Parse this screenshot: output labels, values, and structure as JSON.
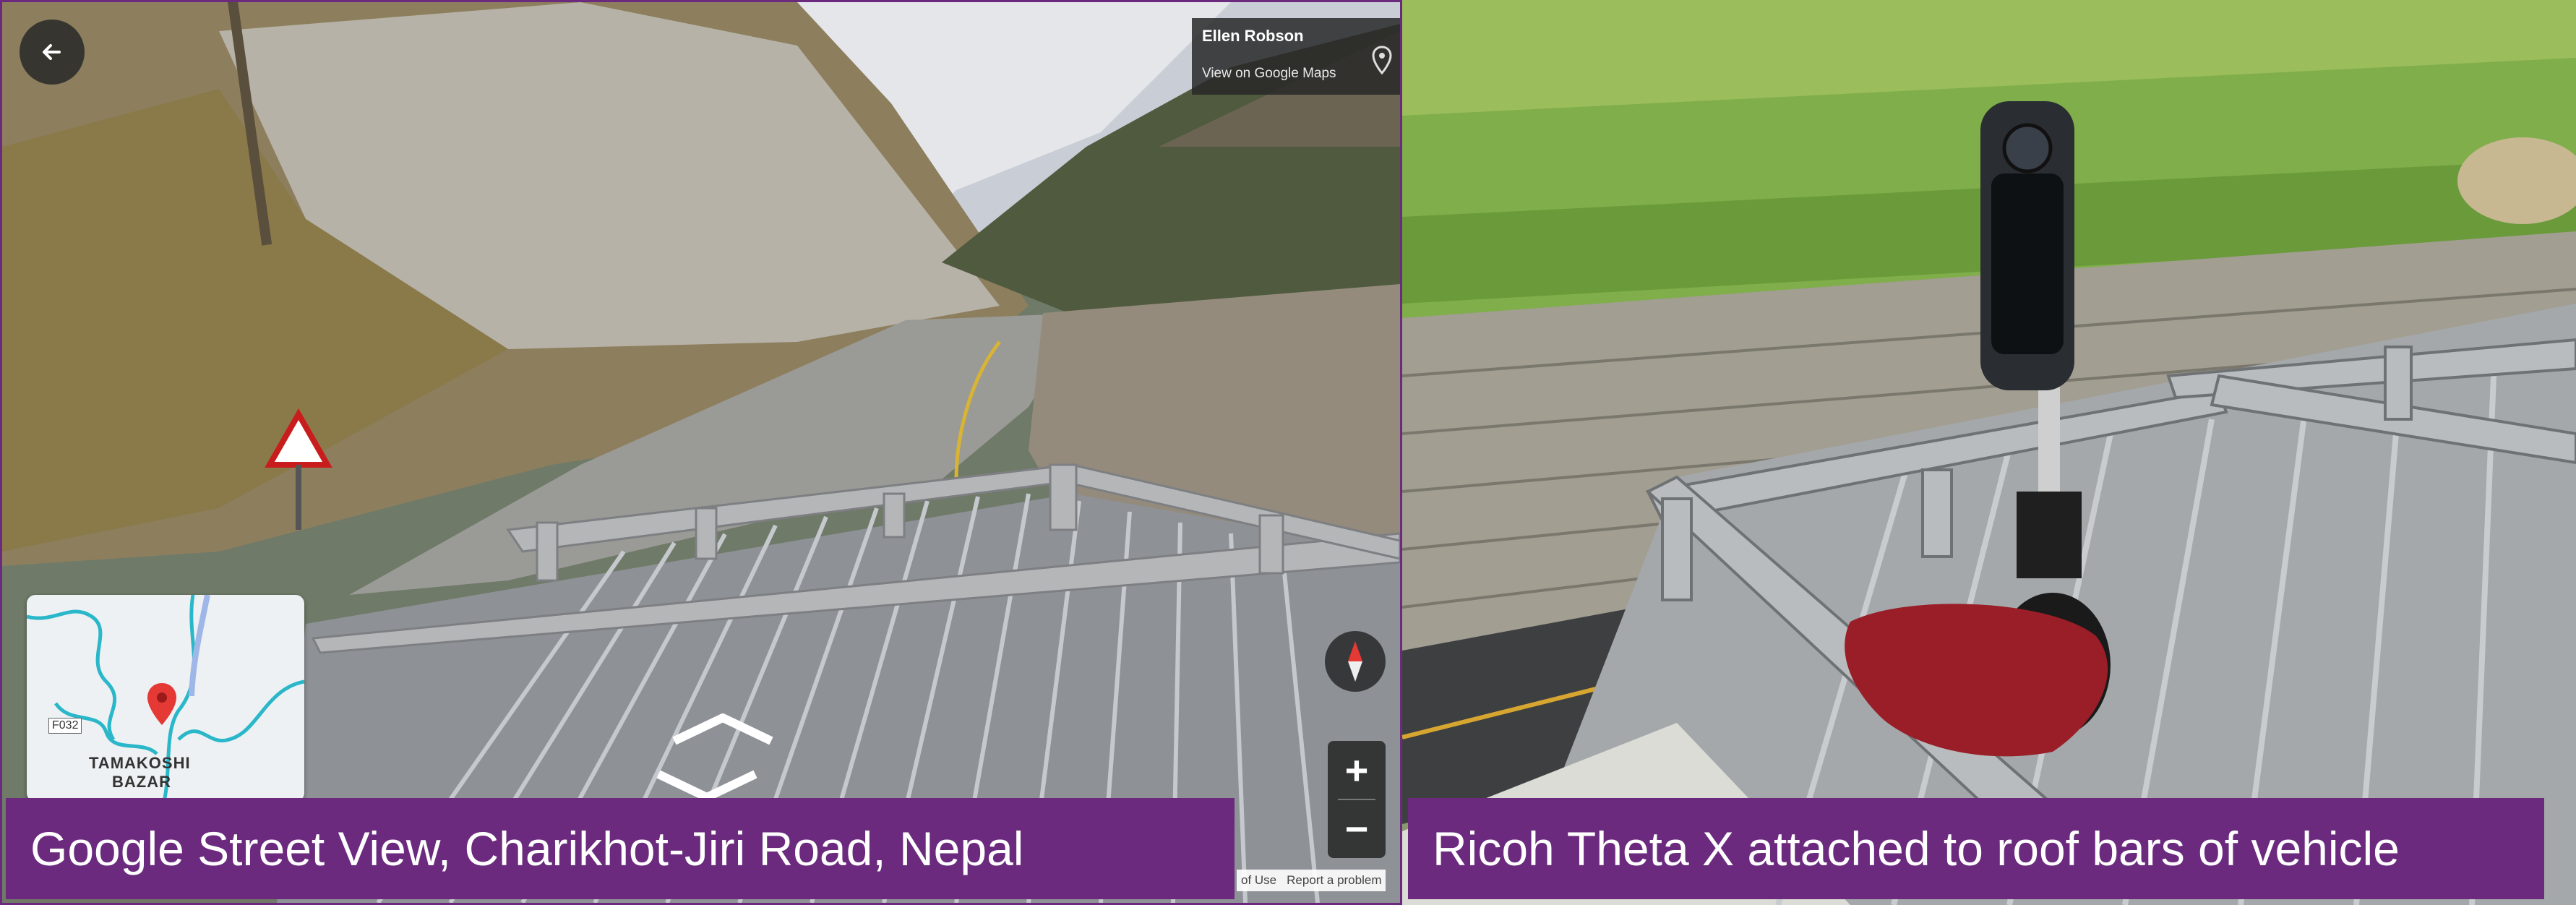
{
  "street_view": {
    "photographer": "Ellen Robson",
    "view_link": "View on Google Maps",
    "map": {
      "place_label_1": "TAMAKOSHI",
      "place_label_2": "BAZAR",
      "road_code": "F032"
    },
    "zoom_in": "+",
    "zoom_out": "−",
    "footer": {
      "terms": "of Use",
      "report": "Report a problem"
    }
  },
  "captions": {
    "left": "Google Street View, Charikhot-Jiri Road, Nepal",
    "right": "Ricoh Theta X attached to roof bars of vehicle"
  },
  "icons": [
    "back-arrow-icon",
    "map-pin-icon",
    "compass-icon",
    "location-marker-icon",
    "nav-chevron-icon"
  ]
}
